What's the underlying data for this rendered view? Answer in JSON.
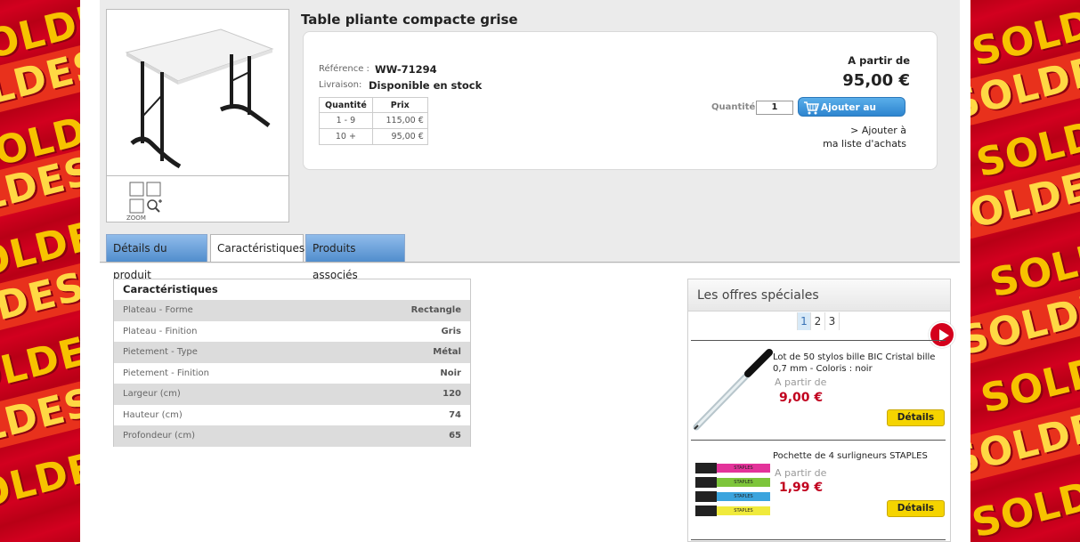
{
  "banner": {
    "word": "SOLDES"
  },
  "product": {
    "title": "Table pliante compacte grise",
    "reference_label": "Référence :",
    "reference_value": "WW-71294",
    "delivery_label": "Livraison:",
    "delivery_value": "Disponible en stock",
    "zoom_label": "ZOOM",
    "price_table": {
      "headers": [
        "Quantité",
        "Prix"
      ],
      "rows": [
        {
          "qty": "1 - 9",
          "price": "115,00 €"
        },
        {
          "qty": "10 +",
          "price": "95,00 €"
        }
      ]
    },
    "from_label": "A partir de",
    "price": "95,00 €",
    "quantity_label": "Quantité",
    "quantity_value": "1",
    "add_to_cart": "Ajouter au panier",
    "wishlist_line1": "> Ajouter à",
    "wishlist_line2": "ma liste d'achats"
  },
  "tabs": [
    {
      "label": "Détails du produit"
    },
    {
      "label": "Caractéristiques"
    },
    {
      "label": "Produits associés"
    }
  ],
  "characteristics": {
    "title": "Caractéristiques",
    "rows": [
      {
        "name": "Plateau - Forme",
        "value": "Rectangle"
      },
      {
        "name": "Plateau - Finition",
        "value": "Gris"
      },
      {
        "name": "Pietement - Type",
        "value": "Métal"
      },
      {
        "name": "Pietement - Finition",
        "value": "Noir"
      },
      {
        "name": "Largeur (cm)",
        "value": "120"
      },
      {
        "name": "Hauteur (cm)",
        "value": "74"
      },
      {
        "name": "Profondeur (cm)",
        "value": "65"
      }
    ]
  },
  "offers": {
    "title": "Les offres spéciales",
    "pages": [
      "1",
      "2",
      "3"
    ],
    "items": [
      {
        "name": "Lot de 50 stylos bille BIC Cristal bille 0,7 mm - Coloris : noir",
        "from": "A partir de",
        "price": "9,00 €",
        "button": "Détails"
      },
      {
        "name": "Pochette de 4 surligneurs STAPLES",
        "from": "A partir de",
        "price": "1,99 €",
        "button": "Détails"
      }
    ],
    "highlighter_brand": "STAPLES"
  },
  "colors": {
    "accent_red": "#c1001e",
    "cart_blue": "#2d85cf",
    "detail_yellow": "#f5d400"
  }
}
